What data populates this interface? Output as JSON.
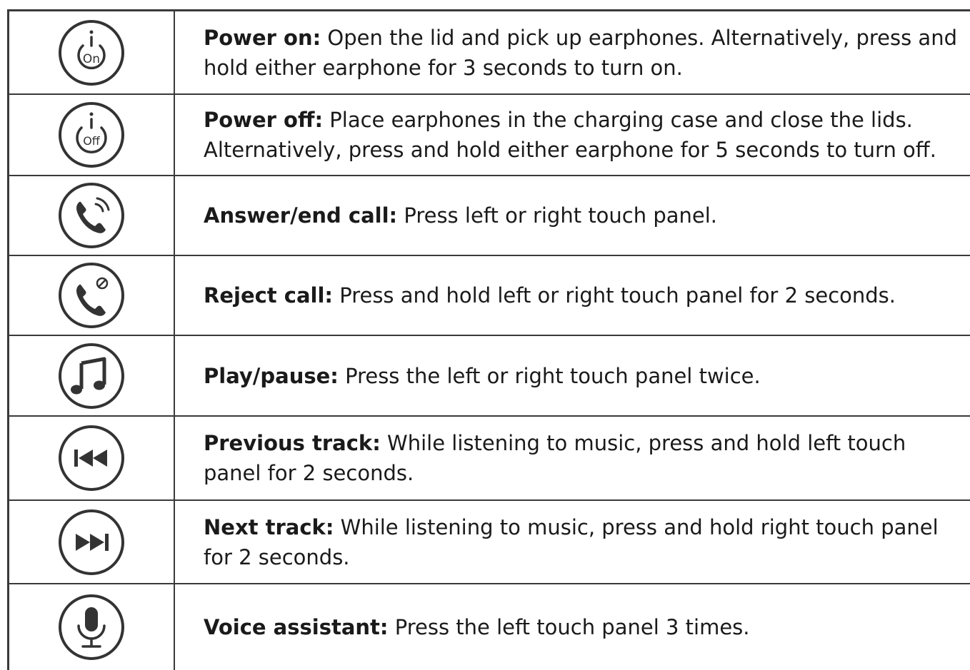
{
  "rows": [
    {
      "icon": "power-on-icon",
      "icon_text": "On",
      "label": "Power on:",
      "text": "Open the lid and pick up earphones. Alternatively, press and hold either earphone for 3 seconds to turn on."
    },
    {
      "icon": "power-off-icon",
      "icon_text": "Off",
      "label": "Power off:",
      "text": "Place earphones in the charging case and close the lids. Alternatively, press and hold either earphone for 5 seconds to turn off."
    },
    {
      "icon": "phone-call-icon",
      "label": "Answer/end call:",
      "text": "Press left or right touch panel."
    },
    {
      "icon": "phone-reject-icon",
      "label": "Reject call:",
      "text": "Press and hold left or right touch panel for 2 seconds."
    },
    {
      "icon": "music-note-icon",
      "label": "Play/pause:",
      "text": "Press the left or right touch panel twice."
    },
    {
      "icon": "previous-track-icon",
      "label": "Previous track:",
      "text": "While listening to music, press and hold left touch panel for 2 seconds."
    },
    {
      "icon": "next-track-icon",
      "label": "Next track:",
      "text": "While listening to music, press and hold right touch panel for 2 seconds."
    },
    {
      "icon": "microphone-icon",
      "label": "Voice assistant:",
      "text": "Press the left touch panel 3 times."
    }
  ],
  "colors": {
    "border": "#3a3a3a",
    "text": "#1a1a1a",
    "icon": "#333333"
  }
}
